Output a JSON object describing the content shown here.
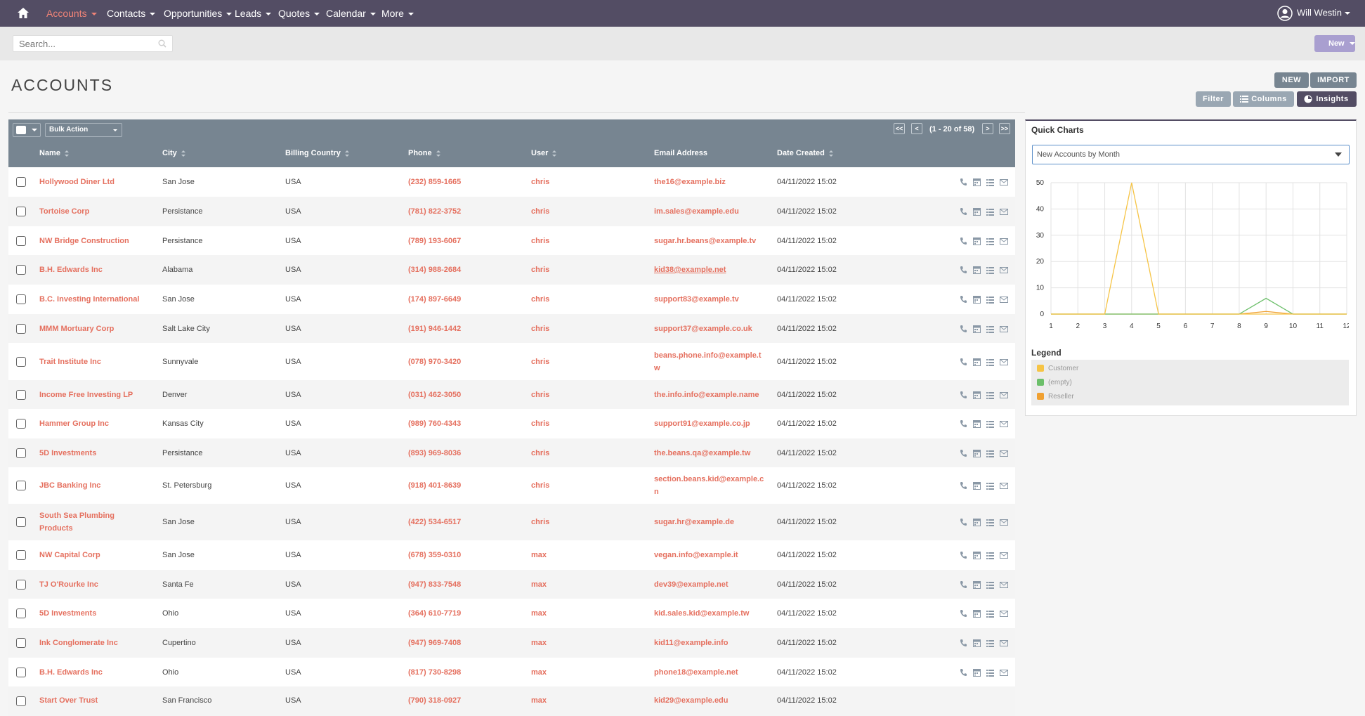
{
  "nav": {
    "home_icon": "home-icon",
    "items": [
      {
        "label": "Accounts",
        "active": true
      },
      {
        "label": "Contacts"
      },
      {
        "label": "Opportunities"
      },
      {
        "label": "Leads"
      },
      {
        "label": "Quotes"
      },
      {
        "label": "Calendar"
      },
      {
        "label": "More"
      }
    ],
    "user_name": "Will Westin"
  },
  "search": {
    "placeholder": "Search..."
  },
  "new_menu_label": "New",
  "page_title": "ACCOUNTS",
  "actions": {
    "new": "NEW",
    "import": "IMPORT",
    "filter": "Filter",
    "columns": "Columns",
    "insights": "Insights"
  },
  "list": {
    "bulk_action": "Bulk Action",
    "pagination": {
      "first": "<<",
      "prev": "<",
      "info": "(1 - 20 of 58)",
      "next": ">",
      "last": ">>"
    },
    "columns": [
      "Name",
      "City",
      "Billing Country",
      "Phone",
      "User",
      "Email Address",
      "Date Created"
    ],
    "rows": [
      {
        "name": "Hollywood Diner Ltd",
        "city": "San Jose",
        "country": "USA",
        "phone": "(232) 859-1665",
        "user": "chris",
        "email": "the16@example.biz",
        "date": "04/11/2022 15:02"
      },
      {
        "name": "Tortoise Corp",
        "city": "Persistance",
        "country": "USA",
        "phone": "(781) 822-3752",
        "user": "chris",
        "email": "im.sales@example.edu",
        "date": "04/11/2022 15:02"
      },
      {
        "name": "NW Bridge Construction",
        "city": "Persistance",
        "country": "USA",
        "phone": "(789) 193-6067",
        "user": "chris",
        "email": "sugar.hr.beans@example.tv",
        "date": "04/11/2022 15:02"
      },
      {
        "name": "B.H. Edwards Inc",
        "city": "Alabama",
        "country": "USA",
        "phone": "(314) 988-2684",
        "user": "chris",
        "email": "kid38@example.net",
        "date": "04/11/2022 15:02"
      },
      {
        "name": "B.C. Investing International",
        "city": "San Jose",
        "country": "USA",
        "phone": "(174) 897-6649",
        "user": "chris",
        "email": "support83@example.tv",
        "date": "04/11/2022 15:02"
      },
      {
        "name": "MMM Mortuary Corp",
        "city": "Salt Lake City",
        "country": "USA",
        "phone": "(191) 946-1442",
        "user": "chris",
        "email": "support37@example.co.uk",
        "date": "04/11/2022 15:02"
      },
      {
        "name": "Trait Institute Inc",
        "city": "Sunnyvale",
        "country": "USA",
        "phone": "(078) 970-3420",
        "user": "chris",
        "email": "beans.phone.info@example.tw",
        "date": "04/11/2022 15:02"
      },
      {
        "name": "Income Free Investing LP",
        "city": "Denver",
        "country": "USA",
        "phone": "(031) 462-3050",
        "user": "chris",
        "email": "the.info.info@example.name",
        "date": "04/11/2022 15:02"
      },
      {
        "name": "Hammer Group Inc",
        "city": "Kansas City",
        "country": "USA",
        "phone": "(989) 760-4343",
        "user": "chris",
        "email": "support91@example.co.jp",
        "date": "04/11/2022 15:02"
      },
      {
        "name": "5D Investments",
        "city": "Persistance",
        "country": "USA",
        "phone": "(893) 969-8036",
        "user": "chris",
        "email": "the.beans.qa@example.tw",
        "date": "04/11/2022 15:02"
      },
      {
        "name": "JBC Banking Inc",
        "city": "St. Petersburg",
        "country": "USA",
        "phone": "(918) 401-8639",
        "user": "chris",
        "email": "section.beans.kid@example.cn",
        "date": "04/11/2022 15:02"
      },
      {
        "name": "South Sea Plumbing Products",
        "city": "San Jose",
        "country": "USA",
        "phone": "(422) 534-6517",
        "user": "chris",
        "email": "sugar.hr@example.de",
        "date": "04/11/2022 15:02"
      },
      {
        "name": "NW Capital Corp",
        "city": "San Jose",
        "country": "USA",
        "phone": "(678) 359-0310",
        "user": "max",
        "email": "vegan.info@example.it",
        "date": "04/11/2022 15:02"
      },
      {
        "name": "TJ O'Rourke Inc",
        "city": "Santa Fe",
        "country": "USA",
        "phone": "(947) 833-7548",
        "user": "max",
        "email": "dev39@example.net",
        "date": "04/11/2022 15:02"
      },
      {
        "name": "5D Investments",
        "city": "Ohio",
        "country": "USA",
        "phone": "(364) 610-7719",
        "user": "max",
        "email": "kid.sales.kid@example.tw",
        "date": "04/11/2022 15:02"
      },
      {
        "name": "Ink Conglomerate Inc",
        "city": "Cupertino",
        "country": "USA",
        "phone": "(947) 969-7408",
        "user": "max",
        "email": "kid11@example.info",
        "date": "04/11/2022 15:02"
      },
      {
        "name": "B.H. Edwards Inc",
        "city": "Ohio",
        "country": "USA",
        "phone": "(817) 730-8298",
        "user": "max",
        "email": "phone18@example.net",
        "date": "04/11/2022 15:02"
      },
      {
        "name": "Start Over Trust",
        "city": "San Francisco",
        "country": "USA",
        "phone": "(790) 318-0927",
        "user": "max",
        "email": "kid29@example.edu",
        "date": "04/11/2022 15:02"
      }
    ]
  },
  "insights": {
    "title": "Quick Charts",
    "selected_chart": "New Accounts by Month",
    "legend_title": "Legend"
  },
  "chart_data": {
    "type": "line",
    "title": "",
    "xlabel": "",
    "ylabel": "",
    "x": [
      1,
      2,
      3,
      4,
      5,
      6,
      7,
      8,
      9,
      10,
      11,
      12
    ],
    "ylim": [
      0,
      50
    ],
    "yticks": [
      0,
      10,
      20,
      30,
      40,
      50
    ],
    "grid": true,
    "legend_placement": "below",
    "series": [
      {
        "name": "Customer",
        "color": "#f6c445",
        "values": [
          0,
          0,
          0,
          50,
          0,
          0,
          0,
          0,
          0,
          0,
          0,
          0
        ]
      },
      {
        "name": "(empty)",
        "color": "#6cbf6a",
        "values": [
          0,
          0,
          0,
          0,
          0,
          0,
          0,
          0,
          6,
          0,
          0,
          0
        ]
      },
      {
        "name": "Reseller",
        "color": "#f0a030",
        "values": [
          0,
          0,
          0,
          0,
          0,
          0,
          0,
          0,
          1,
          0,
          0,
          0
        ]
      }
    ]
  }
}
